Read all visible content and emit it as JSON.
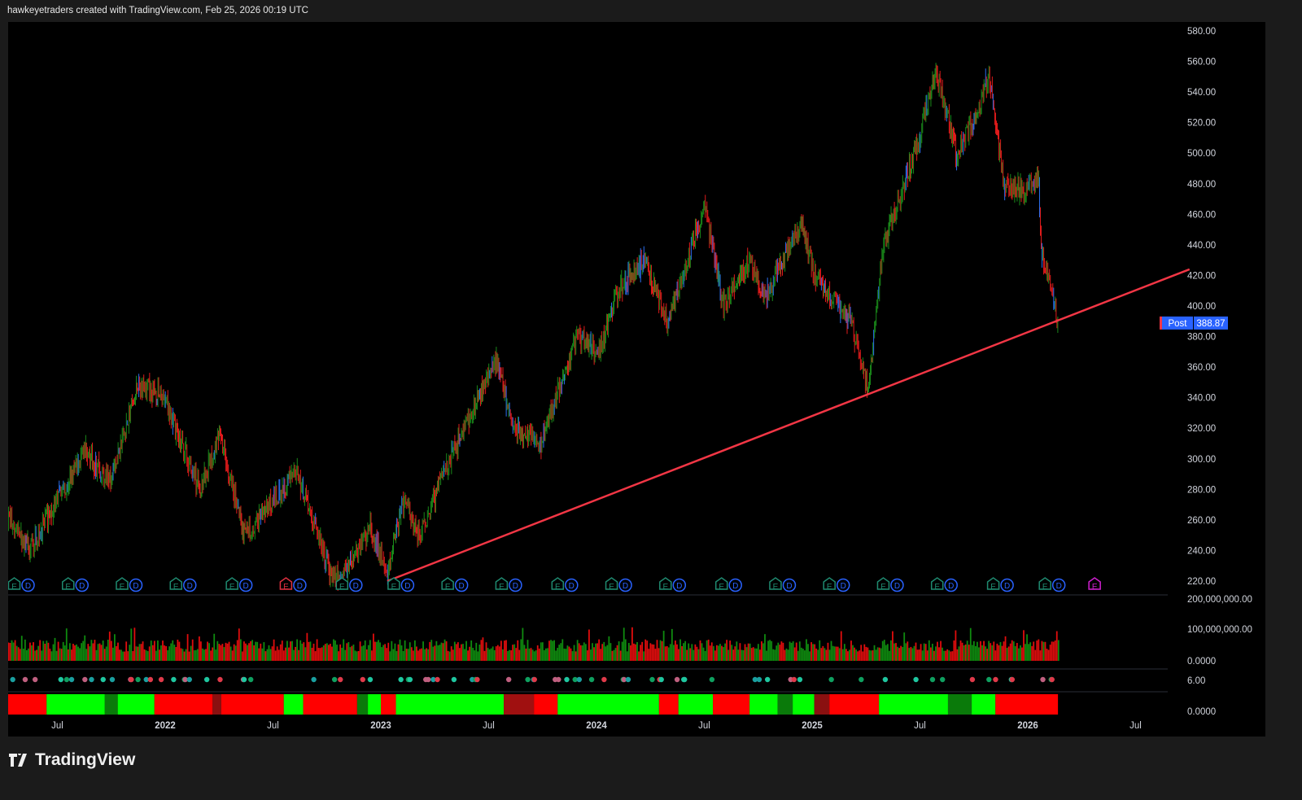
{
  "header": {
    "caption": "hawkeyetraders created with TradingView.com, Feb 25, 2026 00:19 UTC"
  },
  "brand": {
    "name": "TradingView"
  },
  "price_label": {
    "tag": "Post",
    "value": "388.87"
  },
  "colors": {
    "up": "#1a8a1a",
    "down": "#e01b1b",
    "neutral": "#2b6ff0",
    "trendline": "#f23645",
    "post": "#2962ff"
  },
  "chart_data": {
    "type": "line",
    "title": "",
    "price_ticks": [
      "580.00",
      "560.00",
      "540.00",
      "520.00",
      "500.00",
      "480.00",
      "460.00",
      "440.00",
      "420.00",
      "400.00",
      "380.00",
      "360.00",
      "340.00",
      "320.00",
      "300.00",
      "280.00",
      "260.00",
      "240.00",
      "220.00"
    ],
    "ylim": [
      220,
      580
    ],
    "time_ticks": [
      {
        "t": 2021.5,
        "label": "Jul"
      },
      {
        "t": 2022.0,
        "label": "2022"
      },
      {
        "t": 2022.5,
        "label": "Jul"
      },
      {
        "t": 2023.0,
        "label": "2023"
      },
      {
        "t": 2023.5,
        "label": "Jul"
      },
      {
        "t": 2024.0,
        "label": "2024"
      },
      {
        "t": 2024.5,
        "label": "Jul"
      },
      {
        "t": 2025.0,
        "label": "2025"
      },
      {
        "t": 2025.5,
        "label": "Jul"
      },
      {
        "t": 2026.0,
        "label": "2026"
      },
      {
        "t": 2026.5,
        "label": "Jul"
      }
    ],
    "price_path": [
      [
        2021.27,
        262
      ],
      [
        2021.37,
        240
      ],
      [
        2021.63,
        305
      ],
      [
        2021.74,
        285
      ],
      [
        2021.88,
        350
      ],
      [
        2021.99,
        340
      ],
      [
        2022.16,
        280
      ],
      [
        2022.25,
        315
      ],
      [
        2022.37,
        250
      ],
      [
        2022.48,
        270
      ],
      [
        2022.61,
        292
      ],
      [
        2022.78,
        220
      ],
      [
        2022.86,
        232
      ],
      [
        2022.95,
        255
      ],
      [
        2023.03,
        225
      ],
      [
        2023.1,
        272
      ],
      [
        2023.18,
        250
      ],
      [
        2023.29,
        290
      ],
      [
        2023.42,
        330
      ],
      [
        2023.54,
        365
      ],
      [
        2023.61,
        320
      ],
      [
        2023.74,
        310
      ],
      [
        2023.91,
        380
      ],
      [
        2024.01,
        370
      ],
      [
        2024.1,
        410
      ],
      [
        2024.22,
        430
      ],
      [
        2024.33,
        390
      ],
      [
        2024.5,
        465
      ],
      [
        2024.59,
        400
      ],
      [
        2024.71,
        430
      ],
      [
        2024.78,
        405
      ],
      [
        2024.95,
        455
      ],
      [
        2025.01,
        420
      ],
      [
        2025.18,
        390
      ],
      [
        2025.26,
        345
      ],
      [
        2025.33,
        440
      ],
      [
        2025.5,
        510
      ],
      [
        2025.57,
        555
      ],
      [
        2025.67,
        500
      ],
      [
        2025.76,
        525
      ],
      [
        2025.82,
        550
      ],
      [
        2025.89,
        480
      ],
      [
        2025.99,
        475
      ],
      [
        2026.05,
        485
      ],
      [
        2026.06,
        440
      ],
      [
        2026.14,
        388.87
      ]
    ],
    "trendline": [
      [
        2023.03,
        220
      ],
      [
        2026.75,
        424
      ]
    ],
    "volume": {
      "ticks": [
        "200,000,000.00",
        "100,000,000.00",
        "0.0000"
      ],
      "ylim": [
        0,
        200000000
      ]
    },
    "dots_pane": {
      "ticks": [
        "6.00"
      ]
    },
    "heatmap_pane": {
      "ticks": [
        "0.0000"
      ],
      "segments": [
        [
          2021.27,
          2021.45,
          "#ff0000"
        ],
        [
          2021.45,
          2021.72,
          "#00ff00"
        ],
        [
          2021.72,
          2021.78,
          "#0a7a0a"
        ],
        [
          2021.78,
          2021.95,
          "#00ff00"
        ],
        [
          2021.95,
          2022.22,
          "#ff0000"
        ],
        [
          2022.22,
          2022.26,
          "#8a1010"
        ],
        [
          2022.26,
          2022.55,
          "#ff0000"
        ],
        [
          2022.55,
          2022.64,
          "#00ff00"
        ],
        [
          2022.64,
          2022.89,
          "#ff0000"
        ],
        [
          2022.89,
          2022.94,
          "#0a7a0a"
        ],
        [
          2022.94,
          2023.0,
          "#00ff00"
        ],
        [
          2023.0,
          2023.07,
          "#ff0000"
        ],
        [
          2023.07,
          2023.57,
          "#00ff00"
        ],
        [
          2023.57,
          2023.71,
          "#a01010"
        ],
        [
          2023.71,
          2023.82,
          "#ff0000"
        ],
        [
          2023.82,
          2024.29,
          "#00ff00"
        ],
        [
          2024.29,
          2024.38,
          "#ff0000"
        ],
        [
          2024.38,
          2024.54,
          "#00ff00"
        ],
        [
          2024.54,
          2024.71,
          "#ff0000"
        ],
        [
          2024.71,
          2024.84,
          "#00ff00"
        ],
        [
          2024.84,
          2024.91,
          "#0a7a0a"
        ],
        [
          2024.91,
          2025.01,
          "#00ff00"
        ],
        [
          2025.01,
          2025.08,
          "#8a1010"
        ],
        [
          2025.08,
          2025.31,
          "#ff0000"
        ],
        [
          2025.31,
          2025.63,
          "#00ff00"
        ],
        [
          2025.63,
          2025.74,
          "#0a7a0a"
        ],
        [
          2025.74,
          2025.85,
          "#00ff00"
        ],
        [
          2025.85,
          2026.14,
          "#ff0000"
        ]
      ]
    },
    "events": [
      {
        "t": 2021.3,
        "e": "E",
        "d": "D",
        "e_color": "#1f8a70"
      },
      {
        "t": 2021.55,
        "e": "E",
        "d": "D",
        "e_color": "#1f8a70"
      },
      {
        "t": 2021.8,
        "e": "E",
        "d": "D",
        "e_color": "#1f8a70"
      },
      {
        "t": 2022.05,
        "e": "E",
        "d": "D",
        "e_color": "#1f8a70"
      },
      {
        "t": 2022.31,
        "e": "E",
        "d": "D",
        "e_color": "#1f8a70"
      },
      {
        "t": 2022.56,
        "e": "E",
        "d": "D",
        "e_color": "#e03040"
      },
      {
        "t": 2022.82,
        "e": "E",
        "d": "D",
        "e_color": "#1f8a70"
      },
      {
        "t": 2023.06,
        "e": "E",
        "d": "D",
        "e_color": "#1f8a70"
      },
      {
        "t": 2023.31,
        "e": "E",
        "d": "D",
        "e_color": "#1f8a70"
      },
      {
        "t": 2023.56,
        "e": "E",
        "d": "D",
        "e_color": "#1f8a70"
      },
      {
        "t": 2023.82,
        "e": "E",
        "d": "D",
        "e_color": "#1f8a70"
      },
      {
        "t": 2024.07,
        "e": "E",
        "d": "D",
        "e_color": "#1f8a70"
      },
      {
        "t": 2024.32,
        "e": "E",
        "d": "D",
        "e_color": "#1f8a70"
      },
      {
        "t": 2024.58,
        "e": "E",
        "d": "D",
        "e_color": "#1f8a70"
      },
      {
        "t": 2024.83,
        "e": "E",
        "d": "D",
        "e_color": "#1f8a70"
      },
      {
        "t": 2025.08,
        "e": "E",
        "d": "D",
        "e_color": "#1f8a70"
      },
      {
        "t": 2025.33,
        "e": "E",
        "d": "D",
        "e_color": "#1f8a70"
      },
      {
        "t": 2025.58,
        "e": "E",
        "d": "D",
        "e_color": "#1f8a70"
      },
      {
        "t": 2025.84,
        "e": "E",
        "d": "D",
        "e_color": "#1f8a70"
      },
      {
        "t": 2026.08,
        "e": "E",
        "d": "D",
        "e_color": "#1f8a70"
      },
      {
        "t": 2026.31,
        "e": "E",
        "d": "",
        "e_color": "#d020d0"
      }
    ]
  }
}
